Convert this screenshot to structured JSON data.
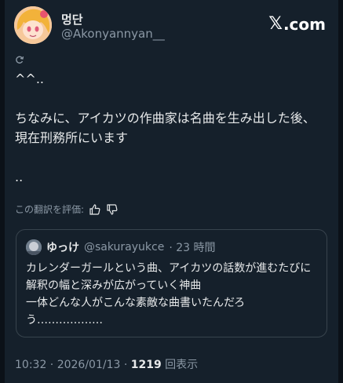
{
  "post": {
    "display_name": "멍단",
    "handle": "@Akonyannyan__",
    "brand": {
      "mark": "𝕏",
      "suffix": ".com"
    },
    "body": "^^..\n\nちなみに、アイカツの作曲家は名曲を生み出した後、現在刑務所にいます\n\n..",
    "translate_prompt": "この翻訳を評価:",
    "timestamp": "10:32 · 2026/01/13 · ",
    "views_count": "1219",
    "views_label": " 回表示"
  },
  "quote": {
    "display_name": "ゆっけ",
    "handle": "@sakurayukce",
    "time": "· 23 時間",
    "body": "カレンダーガールという曲、アイカツの話数が進むたびに解釈の幅と深みが広がっていく神曲\n一体どんな人がこんな素敵な曲書いたんだろう………………"
  },
  "colors": {
    "background": "#15202b",
    "text": "#e7e9ea",
    "muted": "#8b98a5",
    "border": "#38444d"
  },
  "icons": [
    "reply-icon",
    "thumbs-up-icon",
    "thumbs-down-icon"
  ]
}
